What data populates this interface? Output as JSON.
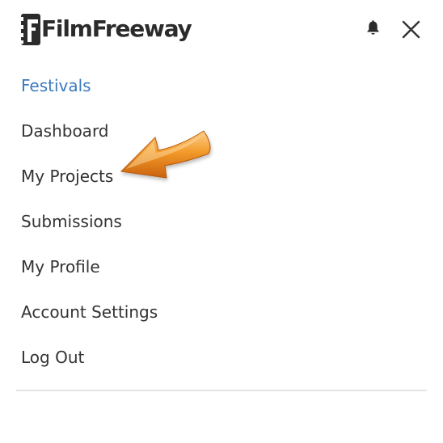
{
  "header": {
    "logo_text": "FilmFreeway",
    "bell_icon": "bell-icon",
    "close_icon": "close-icon"
  },
  "menu": {
    "items": [
      {
        "label": "Festivals",
        "active": true
      },
      {
        "label": "Dashboard",
        "active": false
      },
      {
        "label": "My Projects",
        "active": false
      },
      {
        "label": "Submissions",
        "active": false
      },
      {
        "label": "My Profile",
        "active": false
      },
      {
        "label": "Account Settings",
        "active": false
      },
      {
        "label": "Log Out",
        "active": false
      }
    ]
  },
  "annotation": {
    "icon": "arrow-pointer-icon",
    "color": "#f0921f"
  },
  "colors": {
    "accent": "#3a7bbf",
    "text": "#333333",
    "logo": "#2b2b2b",
    "divider": "#e4e4e4"
  }
}
